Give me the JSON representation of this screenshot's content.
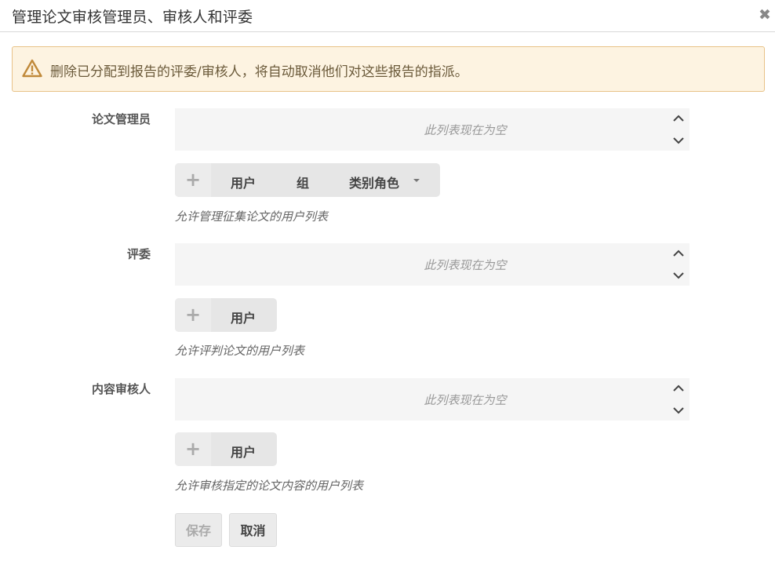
{
  "dialog": {
    "title": "管理论文审核管理员、审核人和评委",
    "close_glyph": "✖"
  },
  "alert": {
    "icon": "warning-triangle-icon",
    "message": "删除已分配到报告的评委/审核人，将自动取消他们对这些报告的指派。",
    "colors": {
      "background": "#fdf3e1",
      "border": "#e8c288",
      "icon": "#c0893a"
    }
  },
  "sections": [
    {
      "label": "论文管理员",
      "list_empty_text": "此列表现在为空",
      "add_glyph": "+",
      "options": [
        "用户",
        "组",
        "类别角色"
      ],
      "help": "允许管理征集论文的用户列表"
    },
    {
      "label": "评委",
      "list_empty_text": "此列表现在为空",
      "add_glyph": "+",
      "options": [
        "用户"
      ],
      "help": "允许评判论文的用户列表"
    },
    {
      "label": "内容审核人",
      "list_empty_text": "此列表现在为空",
      "add_glyph": "+",
      "options": [
        "用户"
      ],
      "help": "允许审核指定的论文内容的用户列表"
    }
  ],
  "actions": {
    "save_label": "保存",
    "cancel_label": "取消"
  }
}
